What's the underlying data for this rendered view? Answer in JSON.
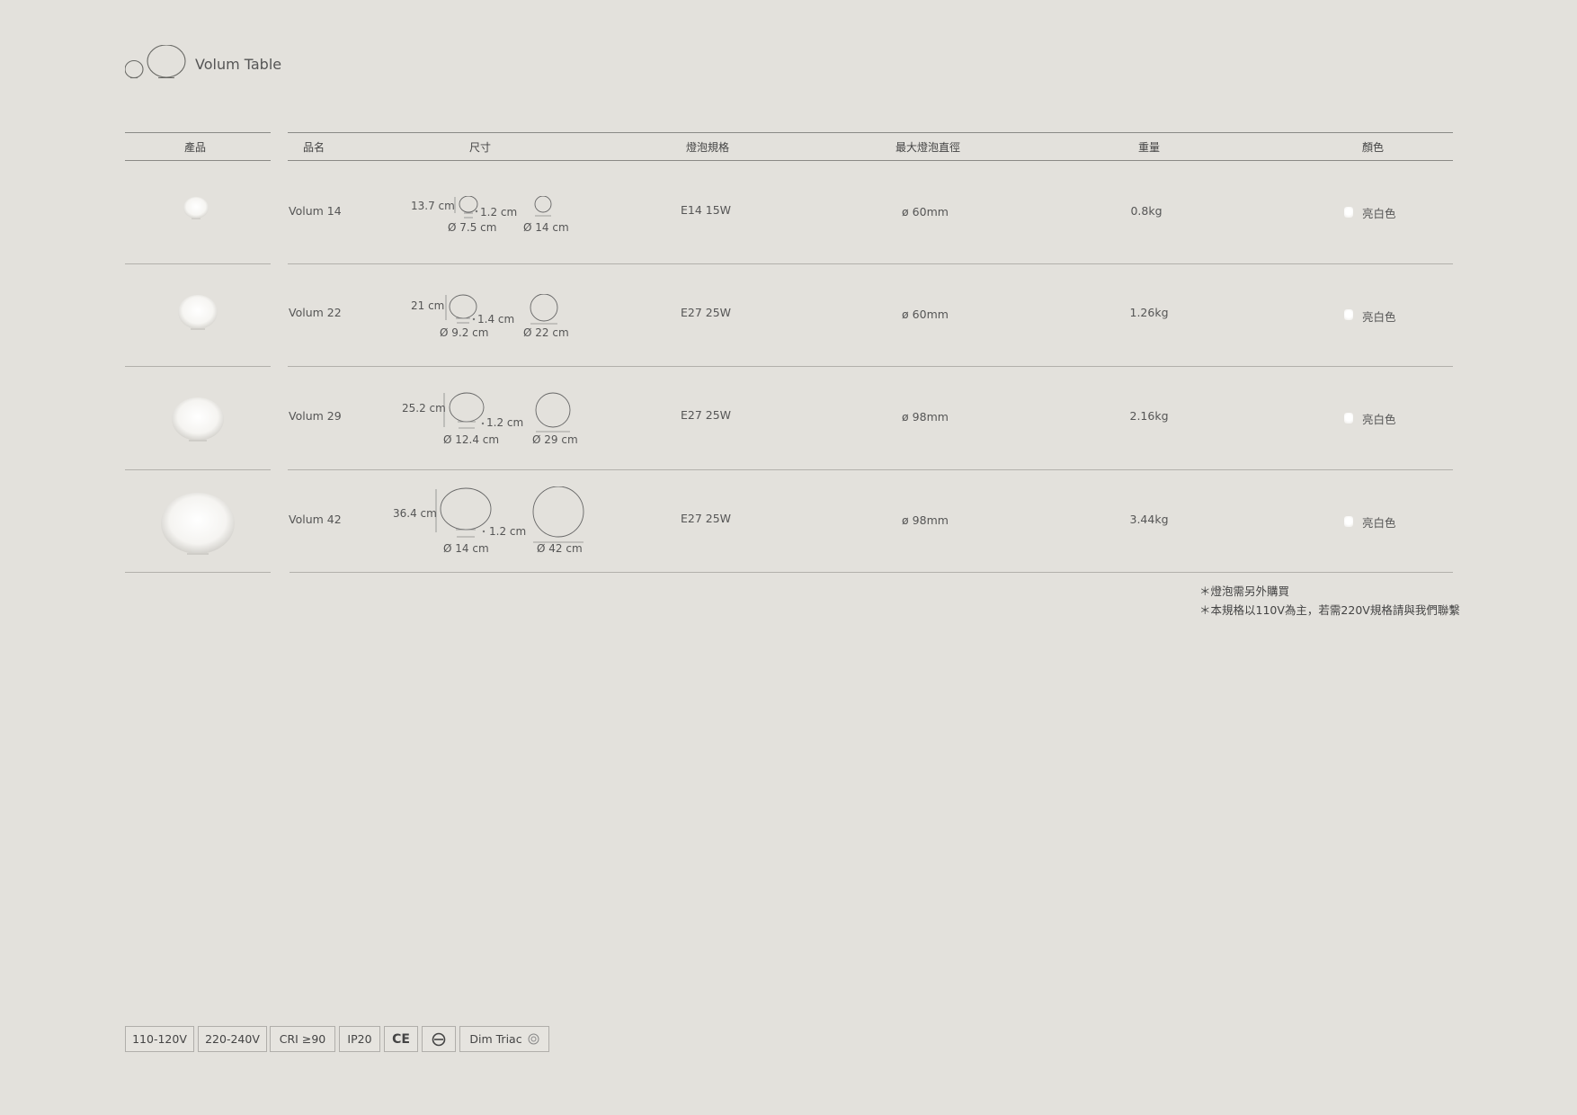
{
  "header": {
    "title": "Volum Table"
  },
  "columns": {
    "product": "產品",
    "name": "品名",
    "size": "尺寸",
    "bulb_spec": "燈泡規格",
    "max_bulb_diameter": "最大燈泡直徑",
    "weight": "重量",
    "color": "顏色"
  },
  "rows": [
    {
      "name": "Volum 14",
      "height": "13.7 cm",
      "base_height": "1.2 cm",
      "base_diameter": "Ø 7.5 cm",
      "diameter": "Ø 14 cm",
      "bulb": "E14 15W",
      "max_bulb": "ø 60mm",
      "weight": "0.8kg",
      "color": "亮白色"
    },
    {
      "name": "Volum 22",
      "height": "21 cm",
      "base_height": "1.4 cm",
      "base_diameter": "Ø 9.2 cm",
      "diameter": "Ø 22 cm",
      "bulb": "E27 25W",
      "max_bulb": "ø 60mm",
      "weight": "1.26kg",
      "color": "亮白色"
    },
    {
      "name": "Volum 29",
      "height": "25.2 cm",
      "base_height": "1.2 cm",
      "base_diameter": "Ø 12.4 cm",
      "diameter": "Ø 29 cm",
      "bulb": "E27 25W",
      "max_bulb": "ø 98mm",
      "weight": "2.16kg",
      "color": "亮白色"
    },
    {
      "name": "Volum 42",
      "height": "36.4 cm",
      "base_height": "1.2 cm",
      "base_diameter": "Ø 14 cm",
      "diameter": "Ø 42 cm",
      "bulb": "E27 25W",
      "max_bulb": "ø 98mm",
      "weight": "3.44kg",
      "color": "亮白色"
    }
  ],
  "notes": [
    "＊燈泡需另外購買",
    "＊本規格以110V為主，若需220V規格請與我們聯繫"
  ],
  "badges": [
    "110-120V",
    "220-240V",
    "CRI ≥90",
    "IP20",
    "CE",
    "",
    "Dim Triac"
  ],
  "colors": {
    "background": "#e3e1dc",
    "rule": "#8a8a86",
    "text": "#4a4a48"
  }
}
